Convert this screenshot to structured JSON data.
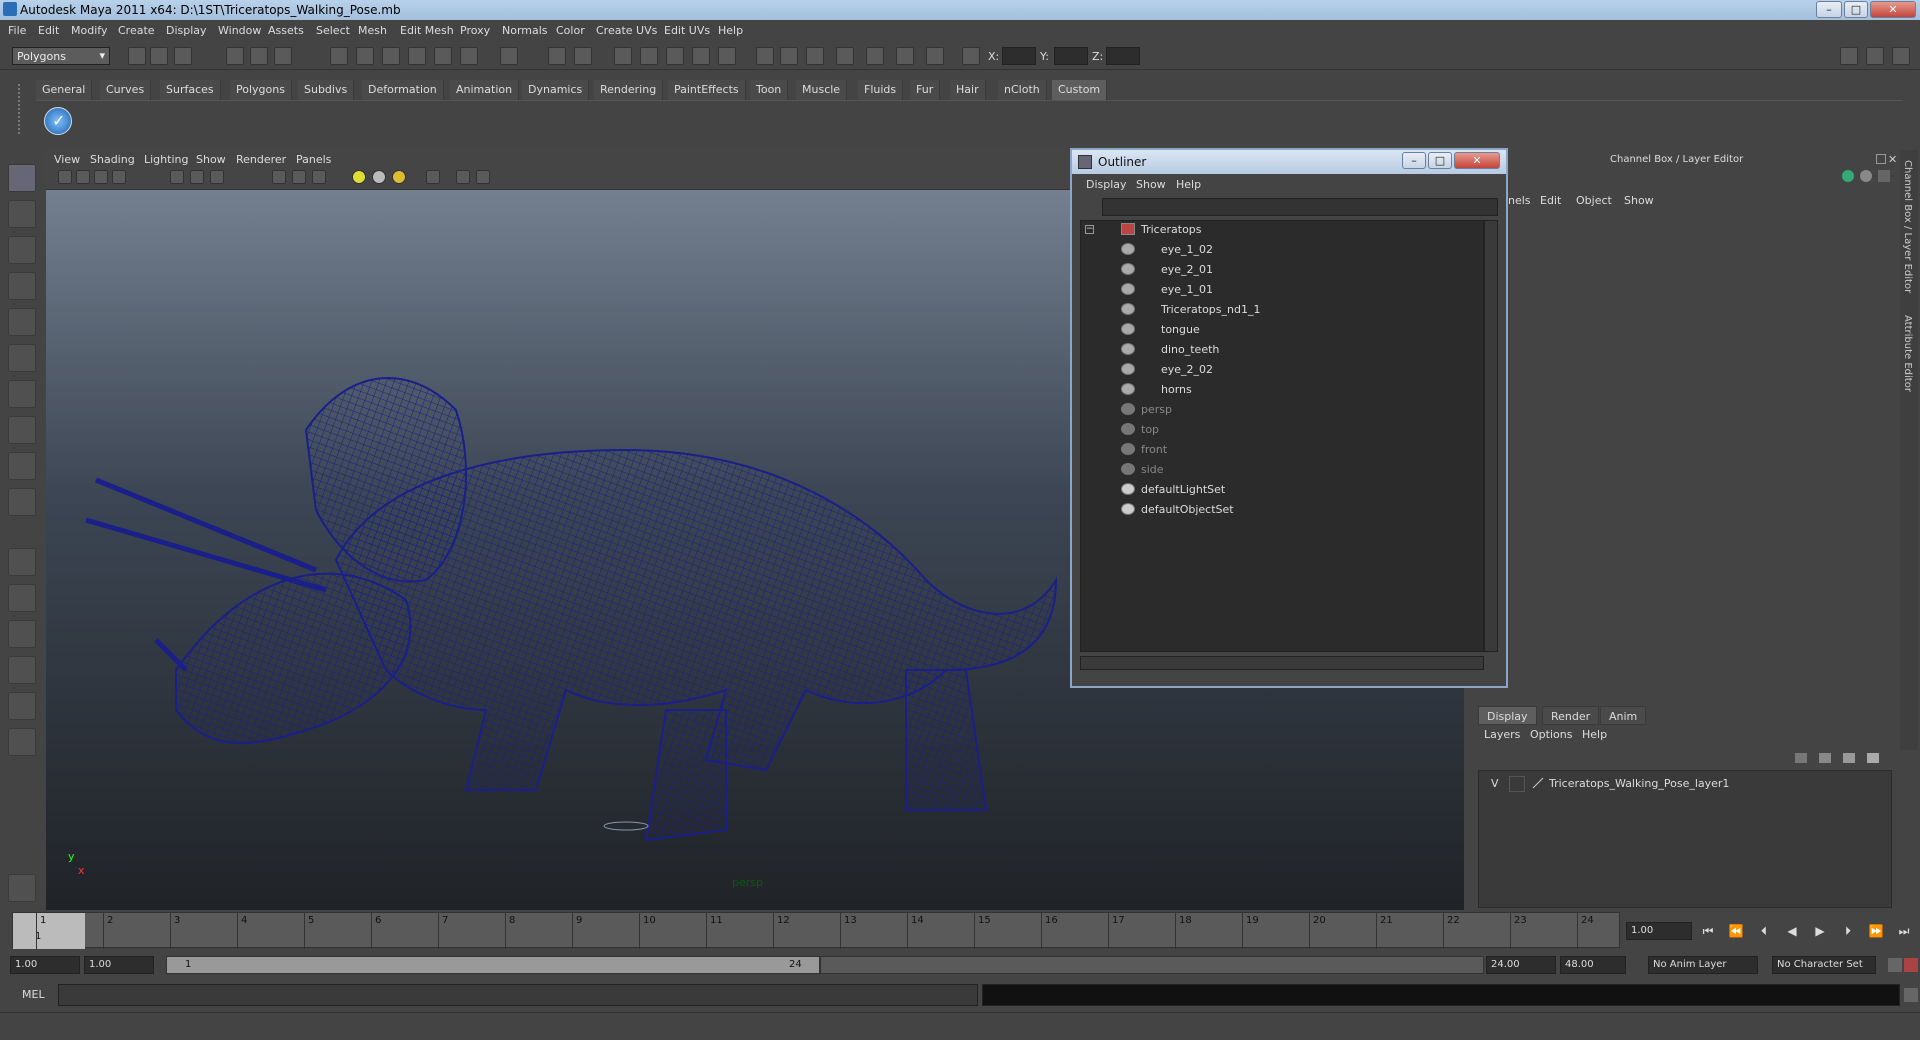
{
  "window": {
    "title": "Autodesk Maya 2011 x64: D:\\1ST\\Triceratops_Walking_Pose.mb",
    "minimize": "–",
    "maximize": "□",
    "close": "✕"
  },
  "menubar": [
    "File",
    "Edit",
    "Modify",
    "Create",
    "Display",
    "Window",
    "Assets",
    "Select",
    "Mesh",
    "Edit Mesh",
    "Proxy",
    "Normals",
    "Color",
    "Create UVs",
    "Edit UVs",
    "Help"
  ],
  "statusline": {
    "mode": "Polygons",
    "x_label": "X:",
    "y_label": "Y:",
    "z_label": "Z:"
  },
  "shelf_tabs": [
    "General",
    "Curves",
    "Surfaces",
    "Polygons",
    "Subdivs",
    "Deformation",
    "Animation",
    "Dynamics",
    "Rendering",
    "PaintEffects",
    "Toon",
    "Muscle",
    "Fluids",
    "Fur",
    "Hair",
    "nCloth",
    "Custom"
  ],
  "active_shelf_tab": "Custom",
  "viewport": {
    "menu": [
      "View",
      "Shading",
      "Lighting",
      "Show",
      "Renderer",
      "Panels"
    ],
    "camera_label": "persp",
    "axis_x": "x",
    "axis_y": "y"
  },
  "outliner": {
    "title": "Outliner",
    "menu": [
      "Display",
      "Show",
      "Help"
    ],
    "items": [
      {
        "label": "Triceratops",
        "type": "group"
      },
      {
        "label": "eye_1_02",
        "type": "mesh"
      },
      {
        "label": "eye_2_01",
        "type": "mesh"
      },
      {
        "label": "eye_1_01",
        "type": "mesh"
      },
      {
        "label": "Triceratops_nd1_1",
        "type": "mesh"
      },
      {
        "label": "tongue",
        "type": "mesh"
      },
      {
        "label": "dino_teeth",
        "type": "mesh"
      },
      {
        "label": "eye_2_02",
        "type": "mesh"
      },
      {
        "label": "horns",
        "type": "mesh"
      },
      {
        "label": "persp",
        "type": "camera"
      },
      {
        "label": "top",
        "type": "camera"
      },
      {
        "label": "front",
        "type": "camera"
      },
      {
        "label": "side",
        "type": "camera"
      },
      {
        "label": "defaultLightSet",
        "type": "set"
      },
      {
        "label": "defaultObjectSet",
        "type": "set"
      }
    ]
  },
  "channel_box": {
    "title": "Channel Box / Layer Editor",
    "menu": [
      "nels",
      "Edit",
      "Object",
      "Show"
    ]
  },
  "layer_editor": {
    "tabs": [
      "Display",
      "Render",
      "Anim"
    ],
    "active_tab": "Display",
    "menu": [
      "Layers",
      "Options",
      "Help"
    ],
    "layer_visible": "V",
    "layer_name": "Triceratops_Walking_Pose_layer1"
  },
  "side_tabs": [
    "Channel Box / Layer Editor",
    "Attribute Editor"
  ],
  "timeslider": {
    "frames": [
      "1",
      "2",
      "3",
      "4",
      "5",
      "6",
      "7",
      "8",
      "9",
      "10",
      "11",
      "12",
      "13",
      "14",
      "15",
      "16",
      "17",
      "18",
      "19",
      "20",
      "21",
      "22",
      "23",
      "24"
    ],
    "current_frame_marker": "1",
    "current_time": "1.00"
  },
  "range": {
    "start_time": "1.00",
    "playback_start": "1.00",
    "range_start_label": "1",
    "range_end_label": "24",
    "playback_end": "24.00",
    "end_time": "48.00",
    "anim_layer": "No Anim Layer",
    "character_set": "No Character Set"
  },
  "command_line": {
    "label": "MEL"
  },
  "colors": {
    "wireframe": "#1a1f8a",
    "panel_bg": "#444444",
    "title_blue": "#b9d1ea"
  }
}
